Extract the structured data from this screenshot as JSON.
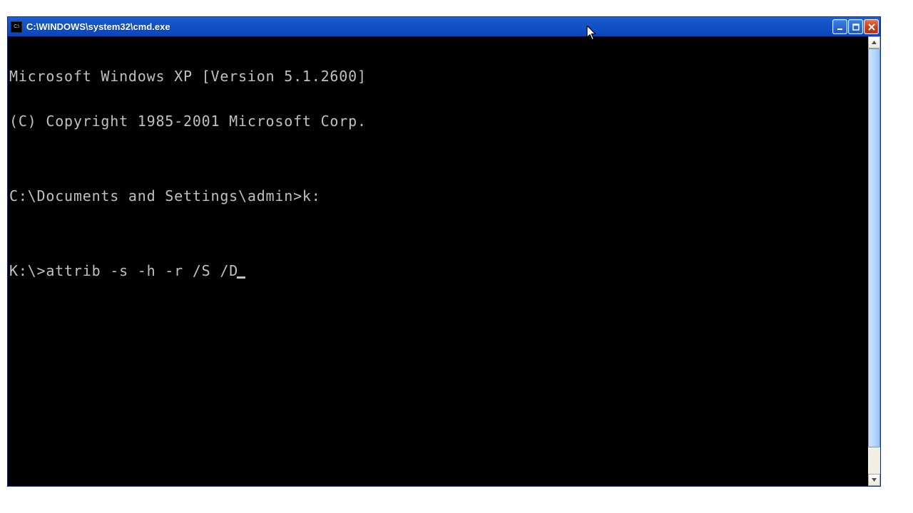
{
  "window": {
    "title": "C:\\WINDOWS\\system32\\cmd.exe",
    "app_icon_label": "C:\\"
  },
  "terminal": {
    "line1": "Microsoft Windows XP [Version 5.1.2600]",
    "line2": "(C) Copyright 1985-2001 Microsoft Corp.",
    "blank1": "",
    "prompt1": "C:\\Documents and Settings\\admin>",
    "cmd1": "k:",
    "blank2": "",
    "prompt2": "K:\\>",
    "cmd2": "attrib -s -h -r /S /D"
  }
}
